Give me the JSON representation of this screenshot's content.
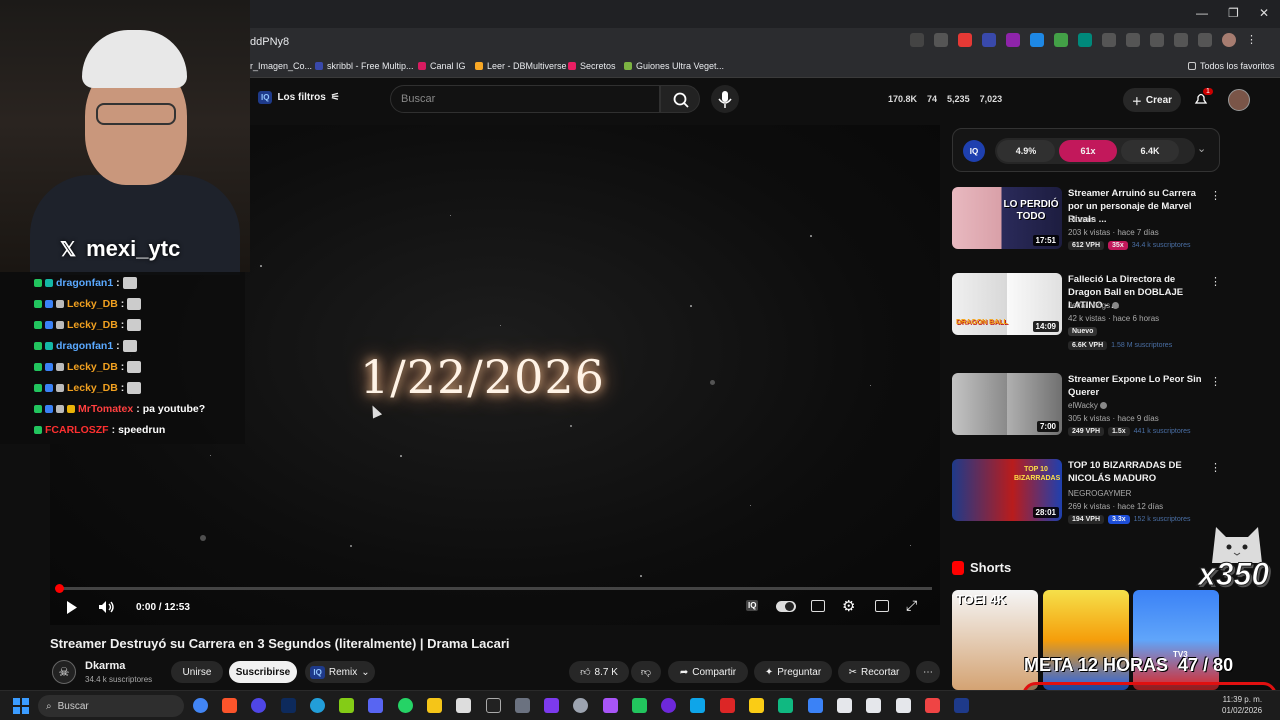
{
  "browser": {
    "url_fragment": "ddPNy8",
    "bookmarks": [
      "r_Imagen_Co...",
      "skribbl - Free Multip...",
      "Canal IG",
      "Leer - DBMultiverse",
      "Secretos",
      "Guiones Ultra Veget..."
    ],
    "favorites_label": "Todos los favoritos"
  },
  "header": {
    "filters_label": "Los filtros",
    "iq_label": "IQ",
    "search_placeholder": "Buscar",
    "stats": [
      "170.8K",
      "74",
      "5,235",
      "7,023"
    ],
    "create_label": "Crear",
    "notifications": "1"
  },
  "player": {
    "overlay_text": "1/22/2026",
    "time": "0:00 / 12:53",
    "progress": 0.005
  },
  "video": {
    "title": "Streamer Destruyó su Carrera en 3 Segundos (literalmente) | Drama Lacari",
    "channel": "Dkarma",
    "subscribers": "34.4 k suscriptores",
    "join_label": "Unirse",
    "subscribe_label": "Suscribirse",
    "remix_label": "Remix",
    "likes": "8.7 K",
    "share_label": "Compartir",
    "ask_label": "Preguntar",
    "clip_label": "Recortar"
  },
  "iq_panel": {
    "logo": "IQ",
    "stats": [
      "4.9%",
      "61x",
      "6.4K"
    ]
  },
  "recommendations": [
    {
      "title": "Streamer Arruinó su Carrera por un personaje de Marvel Rivals ...",
      "channel": "Dkarma",
      "meta": "203 k vistas · hace 7 días",
      "duration": "17:51",
      "thumb_text": "LO PERDIÓ TODO",
      "vph": "612 VPH",
      "mult": "35x",
      "subs": "34.4 k suscriptores",
      "badge": ""
    },
    {
      "title": "Falleció La Directora de Dragon Ball en DOBLAJE LATINO - ...",
      "channel": "Jeffar Vlogs",
      "meta": "42 k vistas · hace 6 horas",
      "duration": "14:09",
      "thumb_text": "DRAGON BALL",
      "vph": "6.6K VPH",
      "mult": "",
      "subs": "1.58 M suscriptores",
      "badge": "Nuevo"
    },
    {
      "title": "Streamer Expone Lo Peor Sin Querer",
      "channel": "elWacky",
      "meta": "305 k vistas · hace 9 días",
      "duration": "7:00",
      "thumb_text": "",
      "vph": "249 VPH",
      "mult": "1.5x",
      "subs": "441 k suscriptores",
      "badge": ""
    },
    {
      "title": "TOP 10 BIZARRADAS DE NICOLÁS MADURO",
      "channel": "NEGROGAYMER",
      "meta": "269 k vistas · hace 12 días",
      "duration": "28:01",
      "thumb_text": "TOP 10 BIZARRADAS",
      "vph": "194 VPH",
      "mult": "3.3x",
      "subs": "152 k suscriptores",
      "badge": ""
    }
  ],
  "shorts": {
    "title": "Shorts",
    "items": [
      "TOEI 4K",
      "",
      "TV3"
    ]
  },
  "stream": {
    "handle": "mexi_ytc",
    "x_label": "𝕏",
    "chat": [
      {
        "user": "dragonfan1",
        "msg": "",
        "color": "#5aa9ff"
      },
      {
        "user": "Lecky_DB",
        "msg": "",
        "color": "#f0a020"
      },
      {
        "user": "Lecky_DB",
        "msg": "",
        "color": "#f0a020"
      },
      {
        "user": "dragonfan1",
        "msg": "",
        "color": "#5aa9ff"
      },
      {
        "user": "Lecky_DB",
        "msg": "",
        "color": "#f0a020"
      },
      {
        "user": "Lecky_DB",
        "msg": "",
        "color": "#f0a020"
      },
      {
        "user": "MrTomatex",
        "msg": "pa youtube?",
        "color": "#ff4040"
      },
      {
        "user": "FCARLOSZF",
        "msg": "speedrun",
        "color": "#ff3030"
      }
    ],
    "sub_count": "x350",
    "goal_label": "META 12 HORAS",
    "goal_current": 47,
    "goal_target": 80,
    "goal_text": "47 / 80"
  },
  "taskbar": {
    "search_label": "Buscar",
    "time": "11:39 p. m.",
    "date": "01/02/2026"
  },
  "colors": {
    "accent": "#ff0000",
    "iq_pink": "#c2185b",
    "background": "#0f0f0f"
  }
}
